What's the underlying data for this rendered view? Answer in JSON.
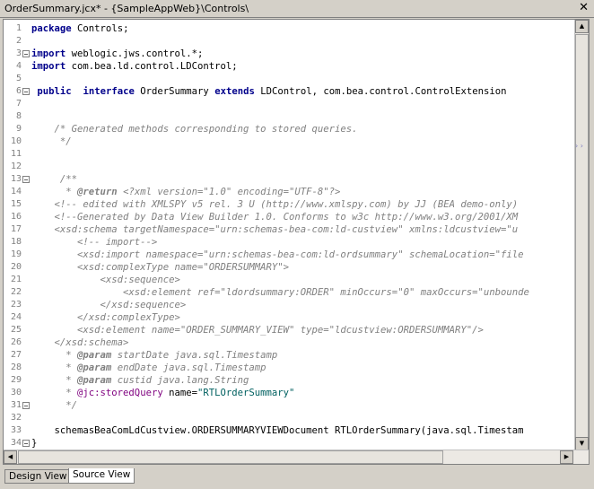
{
  "window": {
    "title": "OrderSummary.jcx* - {SampleAppWeb}\\Controls\\",
    "close_glyph": "✕"
  },
  "editor": {
    "lines": [
      {
        "n": "1",
        "tokens": [
          [
            "kw",
            "package"
          ],
          [
            "",
            "Controls;"
          ]
        ]
      },
      {
        "n": "2",
        "tokens": []
      },
      {
        "n": "3",
        "tokens": [
          [
            "kw",
            "import"
          ],
          [
            "",
            "weblogic.jws.control.*;"
          ]
        ],
        "fold": true
      },
      {
        "n": "4",
        "tokens": [
          [
            "kw",
            "import"
          ],
          [
            "",
            "com.bea.ld.control.LDControl;"
          ]
        ]
      },
      {
        "n": "5",
        "tokens": []
      },
      {
        "n": "6",
        "tokens": [
          [
            "",
            ""
          ],
          [
            "kw",
            "public"
          ],
          [
            "",
            ""
          ],
          [
            "kw",
            "interface"
          ],
          [
            "",
            "OrderSummary"
          ],
          [
            "kw",
            "extends"
          ],
          [
            "",
            "LDControl, com.bea.control.ControlExtension"
          ]
        ],
        "fold": true
      },
      {
        "n": "7",
        "tokens": [
          [
            "",
            ""
          ]
        ]
      },
      {
        "n": "8",
        "tokens": []
      },
      {
        "n": "9",
        "tokens": [
          [
            "cm",
            "    /* Generated methods corresponding to stored queries."
          ]
        ]
      },
      {
        "n": "10",
        "tokens": [
          [
            "cm",
            "     */"
          ]
        ]
      },
      {
        "n": "11",
        "tokens": []
      },
      {
        "n": "12",
        "tokens": []
      },
      {
        "n": "13",
        "tokens": [
          [
            "cm",
            "     /**"
          ]
        ],
        "fold": true
      },
      {
        "n": "14",
        "tokens": [
          [
            "cm",
            "      * "
          ],
          [
            "tag",
            "@return"
          ],
          [
            "cm",
            " <?xml version=\"1.0\" encoding=\"UTF-8\"?>"
          ]
        ]
      },
      {
        "n": "15",
        "tokens": [
          [
            "cm",
            "    <!-- edited with XMLSPY v5 rel. 3 U (http://www.xmlspy.com) by JJ (BEA demo-only)"
          ]
        ]
      },
      {
        "n": "16",
        "tokens": [
          [
            "cm",
            "    <!--Generated by Data View Builder 1.0. Conforms to w3c http://www.w3.org/2001/XM"
          ]
        ]
      },
      {
        "n": "17",
        "tokens": [
          [
            "cm",
            "    <xsd:schema targetNamespace=\"urn:schemas-bea-com:ld-custview\" xmlns:ldcustview=\"u"
          ]
        ]
      },
      {
        "n": "18",
        "tokens": [
          [
            "cm",
            "        <!-- import-->"
          ]
        ]
      },
      {
        "n": "19",
        "tokens": [
          [
            "cm",
            "        <xsd:import namespace=\"urn:schemas-bea-com:ld-ordsummary\" schemaLocation=\"file"
          ]
        ]
      },
      {
        "n": "20",
        "tokens": [
          [
            "cm",
            "        <xsd:complexType name=\"ORDERSUMMARY\">"
          ]
        ]
      },
      {
        "n": "21",
        "tokens": [
          [
            "cm",
            "            <xsd:sequence>"
          ]
        ]
      },
      {
        "n": "22",
        "tokens": [
          [
            "cm",
            "                <xsd:element ref=\"ldordsummary:ORDER\" minOccurs=\"0\" maxOccurs=\"unbounde"
          ]
        ]
      },
      {
        "n": "23",
        "tokens": [
          [
            "cm",
            "            </xsd:sequence>"
          ]
        ]
      },
      {
        "n": "24",
        "tokens": [
          [
            "cm",
            "        </xsd:complexType>"
          ]
        ]
      },
      {
        "n": "25",
        "tokens": [
          [
            "cm",
            "        <xsd:element name=\"ORDER_SUMMARY_VIEW\" type=\"ldcustview:ORDERSUMMARY\"/>"
          ]
        ]
      },
      {
        "n": "26",
        "tokens": [
          [
            "cm",
            "    </xsd:schema>"
          ]
        ]
      },
      {
        "n": "27",
        "tokens": [
          [
            "cm",
            "      * "
          ],
          [
            "tag",
            "@param"
          ],
          [
            "cm",
            " startDate java.sql.Timestamp"
          ]
        ]
      },
      {
        "n": "28",
        "tokens": [
          [
            "cm",
            "      * "
          ],
          [
            "tag",
            "@param"
          ],
          [
            "cm",
            " endDate java.sql.Timestamp"
          ]
        ]
      },
      {
        "n": "29",
        "tokens": [
          [
            "cm",
            "      * "
          ],
          [
            "tag",
            "@param"
          ],
          [
            "cm",
            " custid java.lang.String"
          ]
        ]
      },
      {
        "n": "30",
        "tokens": [
          [
            "cm",
            "      * "
          ],
          [
            "ann",
            "@jc:storedQuery"
          ],
          [
            "",
            "name="
          ],
          [
            "str",
            "\"RTLOrderSummary\""
          ]
        ]
      },
      {
        "n": "31",
        "tokens": [
          [
            "cm",
            "      */"
          ]
        ],
        "fold": true
      },
      {
        "n": "32",
        "tokens": []
      },
      {
        "n": "33",
        "tokens": [
          [
            "",
            "    schemasBeaComLdCustview.ORDERSUMMARYVIEWDocument RTLOrderSummary(java.sql.Timestam"
          ]
        ]
      },
      {
        "n": "34",
        "tokens": [
          [
            "",
            "}"
          ]
        ],
        "fold": true
      }
    ]
  },
  "scrollbars": {
    "up": "▲",
    "down": "▼",
    "left": "◀",
    "right": "▶"
  },
  "tabs": [
    {
      "label": "Design View",
      "active": false
    },
    {
      "label": "Source View",
      "active": true
    }
  ],
  "side_marker": "› ›"
}
